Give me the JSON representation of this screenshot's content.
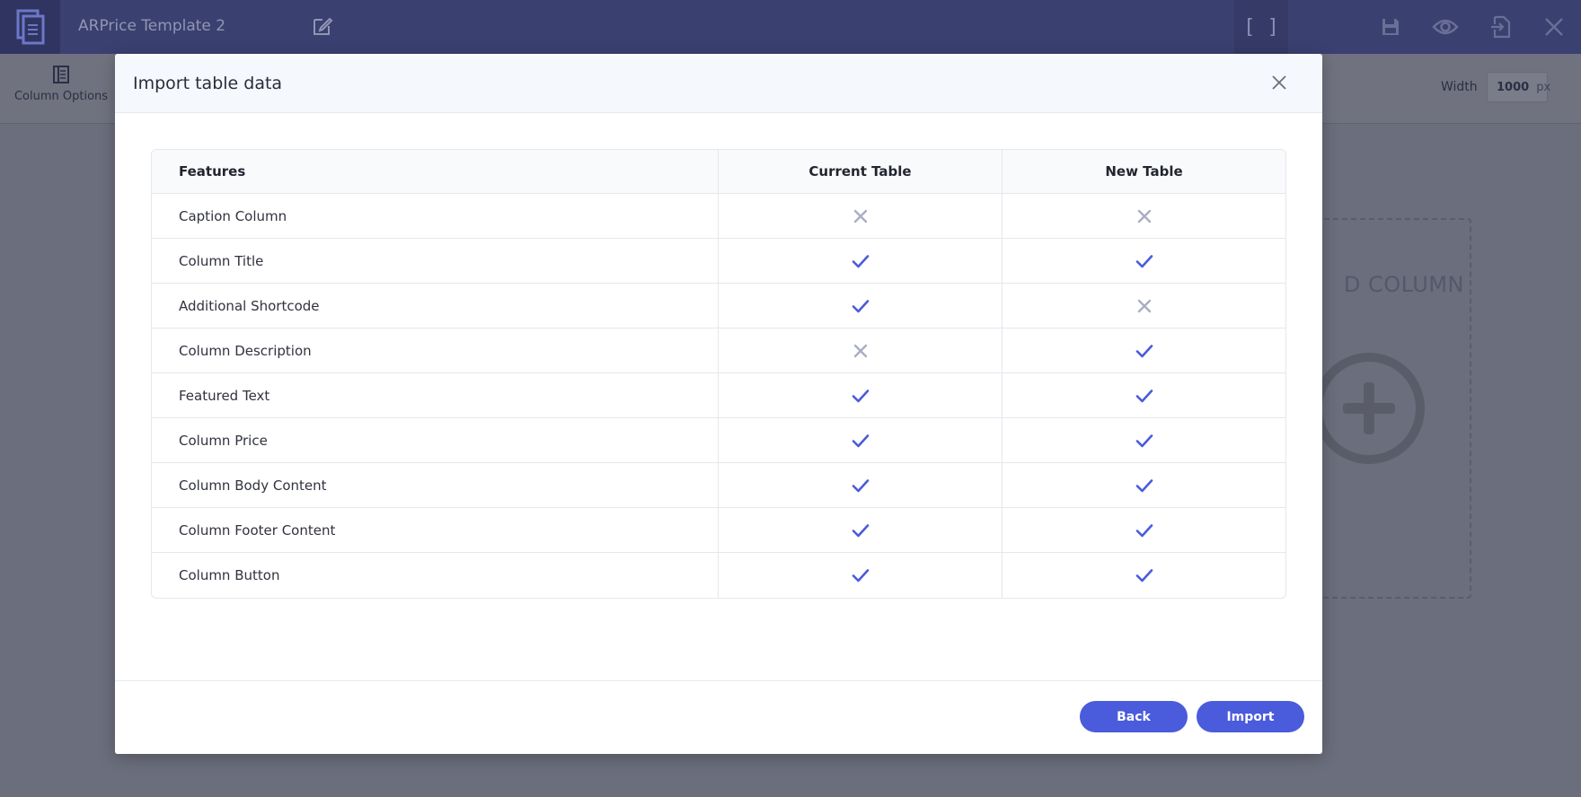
{
  "app": {
    "title": "ARPrice Template 2",
    "bracket_label": "[ ]"
  },
  "toolbar": {
    "column_options_label": "Column Options",
    "width_label": "Width",
    "width_value": "1000",
    "width_unit": "px"
  },
  "canvas": {
    "add_column_label": "D COLUMN"
  },
  "modal": {
    "title": "Import table data",
    "table": {
      "headers": [
        "Features",
        "Current Table",
        "New Table"
      ],
      "rows": [
        {
          "feature": "Caption Column",
          "current": "cross",
          "new": "cross"
        },
        {
          "feature": "Column Title",
          "current": "check",
          "new": "check"
        },
        {
          "feature": "Additional Shortcode",
          "current": "check",
          "new": "cross"
        },
        {
          "feature": "Column Description",
          "current": "cross",
          "new": "check"
        },
        {
          "feature": "Featured Text",
          "current": "check",
          "new": "check"
        },
        {
          "feature": "Column Price",
          "current": "check",
          "new": "check"
        },
        {
          "feature": "Column Body Content",
          "current": "check",
          "new": "check"
        },
        {
          "feature": "Column Footer Content",
          "current": "check",
          "new": "check"
        },
        {
          "feature": "Column Button",
          "current": "check",
          "new": "check"
        }
      ]
    },
    "buttons": {
      "back": "Back",
      "import": "Import"
    }
  },
  "colors": {
    "topbar": "#3a4070",
    "accent": "#4a5bdc",
    "check": "#4a5bdc",
    "cross": "#a9aec2"
  }
}
